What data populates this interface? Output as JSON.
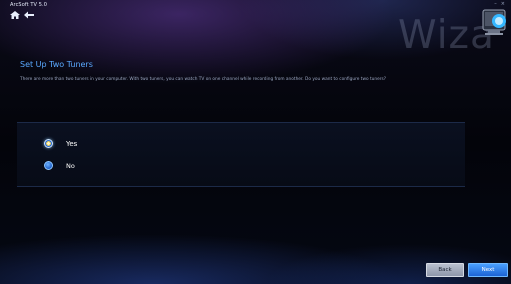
{
  "app": {
    "title": "ArcSoft TV 5.0",
    "window_controls": [
      "–",
      "×"
    ]
  },
  "header": {
    "watermark": "Wiza",
    "nav": [
      "home-icon",
      "back-arrow-icon"
    ]
  },
  "page": {
    "title": "Set Up Two Tuners",
    "description": "There are more than two tuners in your computer. With two tuners, you can watch TV on one channel while recording from another. Do you want to configure two tuners?"
  },
  "options": [
    {
      "label": "Yes",
      "selected": true
    },
    {
      "label": "No",
      "selected": false
    }
  ],
  "buttons": {
    "back": "Back",
    "next": "Next"
  },
  "colors": {
    "accent": "#5aa9ff",
    "next_button": "#2a7de8",
    "back_button": "#a7afc0"
  }
}
